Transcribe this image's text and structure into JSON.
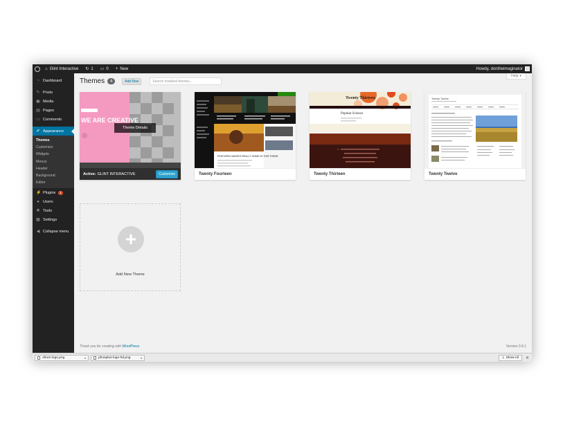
{
  "adminbar": {
    "site_name": "Glint Interactive",
    "updates_count": "1",
    "comments_count": "0",
    "new_label": "New",
    "howdy": "Howdy, dontheimaginator"
  },
  "sidebar": {
    "items": [
      {
        "label": "Dashboard",
        "icon": "dashboard-icon"
      },
      {
        "label": "Posts",
        "icon": "pin-icon"
      },
      {
        "label": "Media",
        "icon": "media-icon"
      },
      {
        "label": "Pages",
        "icon": "page-icon"
      },
      {
        "label": "Comments",
        "icon": "comment-icon"
      },
      {
        "label": "Appearance",
        "icon": "brush-icon"
      }
    ],
    "submenu": [
      "Themes",
      "Customize",
      "Widgets",
      "Menus",
      "Header",
      "Background",
      "Editor"
    ],
    "items2": [
      {
        "label": "Plugins",
        "icon": "plug-icon",
        "badge": "1"
      },
      {
        "label": "Users",
        "icon": "user-icon"
      },
      {
        "label": "Tools",
        "icon": "wrench-icon"
      },
      {
        "label": "Settings",
        "icon": "settings-icon"
      }
    ],
    "collapse": "Collapse menu"
  },
  "main": {
    "help": "Help",
    "title": "Themes",
    "count": "4",
    "add_new": "Add New",
    "search_placeholder": "Search installed themes...",
    "themes": [
      {
        "name": "GLINT INTERACTIVE",
        "active_prefix": "Active:",
        "customize": "Customize",
        "details": "Theme Details",
        "shot_text": "WE ARE CREATIVE"
      },
      {
        "name": "Twenty Fourteen",
        "shot_text": "FEATURED IMAGES REALLY SHINE IN THIS THEME"
      },
      {
        "name": "Twenty Thirteen",
        "shot_title": "Twenty Thirteen",
        "shot_text": "Popular Science"
      },
      {
        "name": "Twenty Twelve",
        "shot_title": "Twenty Twelve"
      }
    ],
    "add_theme": "Add New Theme"
  },
  "footer": {
    "thanks": "Thank you for creating with",
    "wp": "WordPress.",
    "version": "Version 3.8.1"
  },
  "downloads": {
    "items": [
      "Allure-logo.png",
      "phoeplus-logo-hd.png"
    ],
    "show_all": "Show All"
  },
  "colors": {
    "accent": "#0074a2",
    "sidebar": "#222222",
    "customize": "#2ea2cc",
    "badge": "#d54e21"
  }
}
